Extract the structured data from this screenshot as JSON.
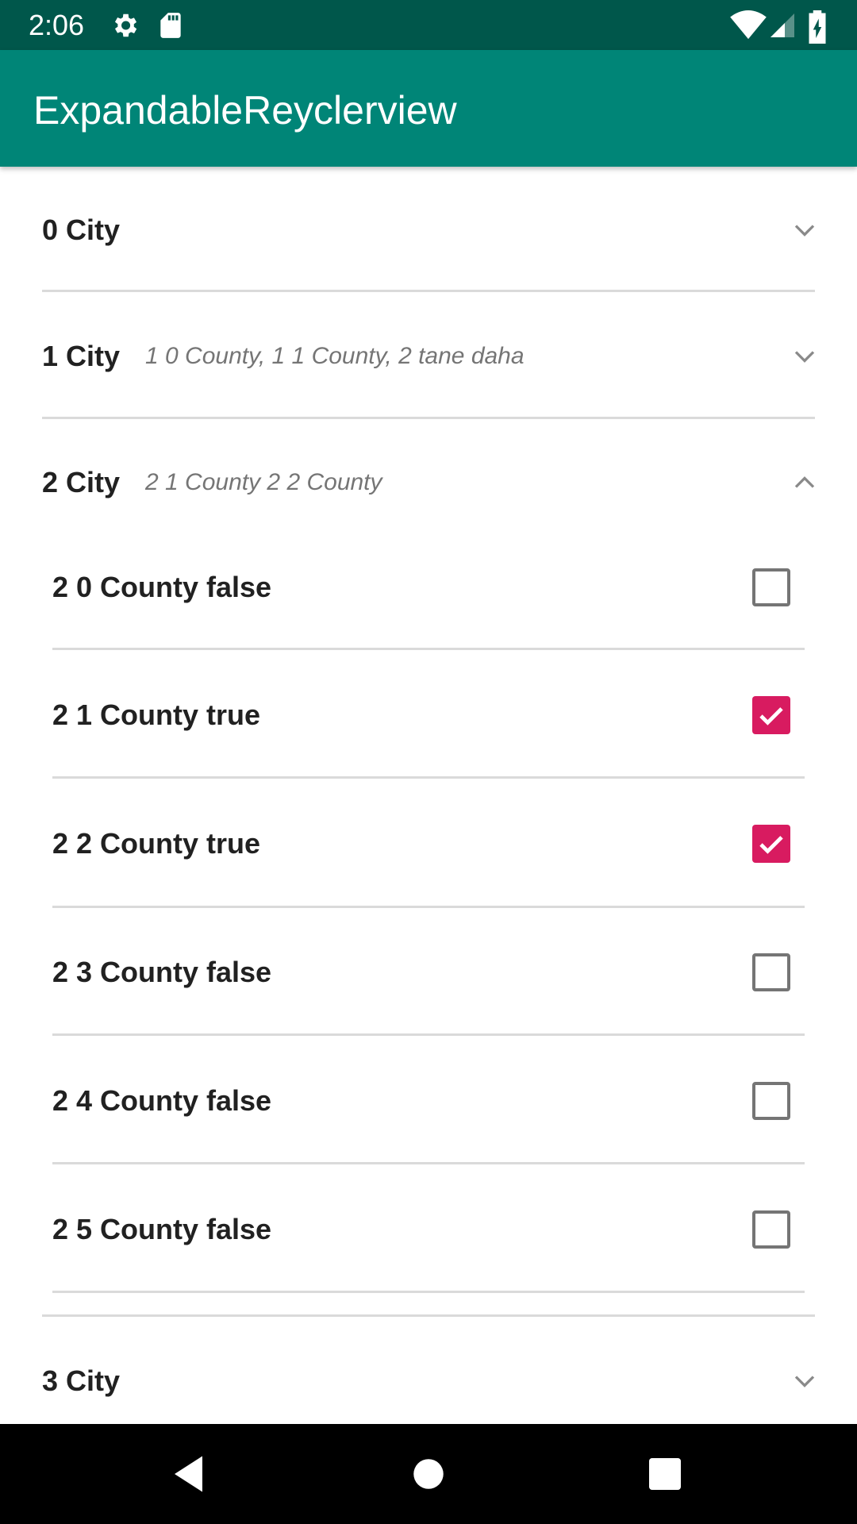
{
  "status_bar": {
    "time": "2:06",
    "left_icons": [
      "gear-icon",
      "sd-card-icon"
    ],
    "right_icons": [
      "wifi-icon",
      "signal-icon",
      "battery-charging-icon"
    ]
  },
  "app_bar": {
    "title": "ExpandableReyclerview",
    "color": "#008577",
    "status_color": "#00574b"
  },
  "accent_color": "#d81b60",
  "groups": [
    {
      "title": "0 City",
      "summary": "",
      "expanded": false
    },
    {
      "title": "1 City",
      "summary": "1 0 County, 1 1 County, 2 tane daha",
      "expanded": false
    },
    {
      "title": "2 City",
      "summary": "2 1 County 2 2 County",
      "expanded": true
    },
    {
      "title": "3 City",
      "summary": "",
      "expanded": false
    }
  ],
  "children": [
    {
      "label": "2 0 County false",
      "checked": false
    },
    {
      "label": "2 1 County true",
      "checked": true
    },
    {
      "label": "2 2 County true",
      "checked": true
    },
    {
      "label": "2 3 County false",
      "checked": false
    },
    {
      "label": "2 4 County false",
      "checked": false
    },
    {
      "label": "2 5 County false",
      "checked": false
    }
  ],
  "nav_bar": {
    "buttons": [
      "back-icon",
      "home-icon",
      "recents-icon"
    ]
  }
}
